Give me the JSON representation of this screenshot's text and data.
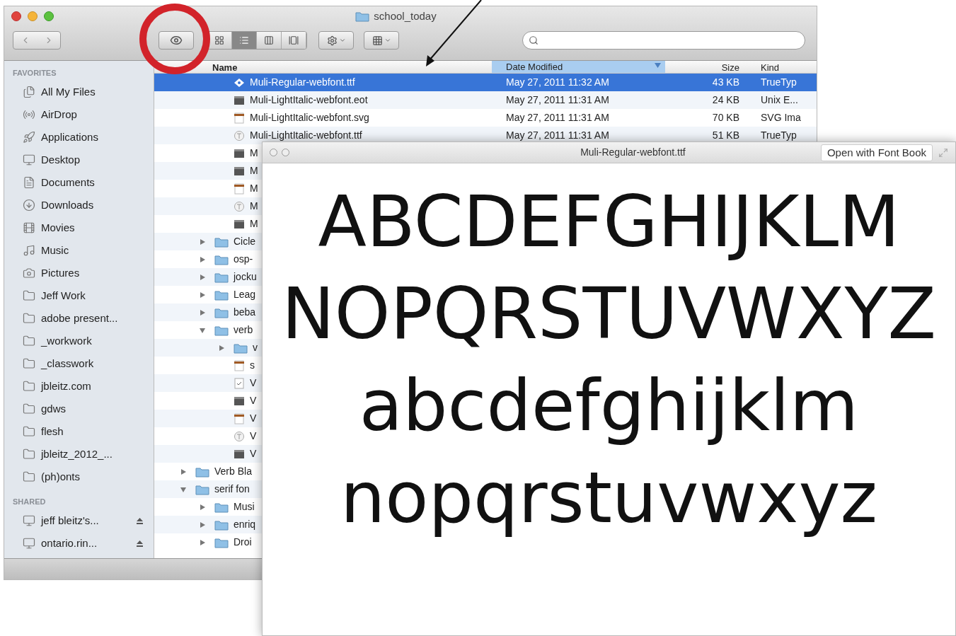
{
  "finder": {
    "title": "school_today",
    "toolbar": {
      "view_buttons": [
        {
          "kind": "icons",
          "selected": false
        },
        {
          "kind": "list",
          "selected": true
        },
        {
          "kind": "columns",
          "selected": false
        },
        {
          "kind": "coverflow",
          "selected": false
        }
      ]
    },
    "sidebar": {
      "sections": [
        {
          "heading": "FAVORITES",
          "items": [
            {
              "kind": "files",
              "label": "All My Files"
            },
            {
              "kind": "airdrop",
              "label": "AirDrop"
            },
            {
              "kind": "apps",
              "label": "Applications"
            },
            {
              "kind": "desktop",
              "label": "Desktop"
            },
            {
              "kind": "documents",
              "label": "Documents"
            },
            {
              "kind": "downloads",
              "label": "Downloads"
            },
            {
              "kind": "movies",
              "label": "Movies"
            },
            {
              "kind": "music",
              "label": "Music"
            },
            {
              "kind": "pictures",
              "label": "Pictures"
            },
            {
              "kind": "folder",
              "label": "Jeff Work"
            },
            {
              "kind": "folder",
              "label": "adobe present..."
            },
            {
              "kind": "folder",
              "label": "_workwork"
            },
            {
              "kind": "folder",
              "label": "_classwork"
            },
            {
              "kind": "folder",
              "label": "jbleitz.com"
            },
            {
              "kind": "folder",
              "label": "gdws"
            },
            {
              "kind": "folder",
              "label": "flesh"
            },
            {
              "kind": "folder",
              "label": "jbleitz_2012_..."
            },
            {
              "kind": "folder",
              "label": "(ph)onts"
            }
          ]
        },
        {
          "heading": "SHARED",
          "items": [
            {
              "kind": "computer",
              "label": "jeff bleitz's...",
              "eject": true
            },
            {
              "kind": "computer",
              "label": "ontario.rin...",
              "eject": true
            }
          ]
        }
      ]
    },
    "columns": [
      "Name",
      "Date Modified",
      "Size",
      "Kind"
    ],
    "rows": [
      {
        "kind": "group",
        "children": [
          {
            "kind": "group",
            "children": [
              {
                "kind": "font",
                "name": "Muli-Regular-webfont.ttf",
                "date": "May 27, 2011 11:32 AM",
                "size": "43 KB",
                "type": "TrueTyp",
                "selected": true
              },
              {
                "kind": "binary",
                "name": "Muli-LightItalic-webfont.eot",
                "date": "May 27, 2011 11:31 AM",
                "size": "24 KB",
                "type": "Unix E...",
                "selected": false
              },
              {
                "kind": "svg",
                "name": "Muli-LightItalic-webfont.svg",
                "date": "May 27, 2011 11:31 AM",
                "size": "70 KB",
                "type": "SVG Ima",
                "selected": false
              },
              {
                "kind": "ttf",
                "name": "Muli-LightItalic-webfont.ttf",
                "date": "May 27, 2011 11:31 AM",
                "size": "51 KB",
                "type": "TrueTyp",
                "selected": false
              },
              {
                "kind": "binary",
                "name": "M",
                "selected": false
              },
              {
                "kind": "binary",
                "name": "M",
                "selected": false
              },
              {
                "kind": "svg",
                "name": "M",
                "selected": false
              },
              {
                "kind": "ttf",
                "name": "M",
                "selected": false
              },
              {
                "kind": "binary",
                "name": "M",
                "selected": false
              }
            ]
          },
          {
            "kind": "folder",
            "name": "Cicle",
            "expanded": false,
            "selected": false
          },
          {
            "kind": "folder",
            "name": "osp-",
            "expanded": false,
            "selected": false
          },
          {
            "kind": "folder",
            "name": "jocku",
            "expanded": false,
            "selected": false
          },
          {
            "kind": "folder",
            "name": "Leag",
            "expanded": false,
            "selected": false
          },
          {
            "kind": "folder",
            "name": "beba",
            "expanded": false,
            "selected": false
          },
          {
            "kind": "folder",
            "name": "verb",
            "expanded": true,
            "selected": false,
            "children": [
              {
                "kind": "folder",
                "name": "v",
                "expanded": false,
                "selected": false
              },
              {
                "kind": "svg",
                "name": "s",
                "selected": false
              },
              {
                "kind": "doc",
                "name": "V",
                "selected": false
              },
              {
                "kind": "binary",
                "name": "V",
                "selected": false
              },
              {
                "kind": "svg",
                "name": "V",
                "selected": false
              },
              {
                "kind": "ttf",
                "name": "V",
                "selected": false
              },
              {
                "kind": "binary",
                "name": "V",
                "selected": false
              }
            ]
          }
        ]
      },
      {
        "kind": "folder",
        "name": "Verb Bla",
        "expanded": false,
        "selected": false
      },
      {
        "kind": "folder",
        "name": "serif fon",
        "expanded": true,
        "selected": false,
        "children": [
          {
            "kind": "folder",
            "name": "Musi",
            "expanded": false,
            "selected": false
          },
          {
            "kind": "folder",
            "name": "enriq",
            "expanded": false,
            "selected": false
          },
          {
            "kind": "folder",
            "name": "Droi",
            "expanded": false,
            "selected": false
          }
        ]
      }
    ]
  },
  "quicklook": {
    "title": "Muli-Regular-webfont.ttf",
    "open_button": "Open with Font Book",
    "sample_lines": [
      "ABCDEFGHIJKLM",
      "NOPQRSTUVWXYZ",
      "abcdefghijklm",
      "nopqrstuvwxyz"
    ]
  }
}
